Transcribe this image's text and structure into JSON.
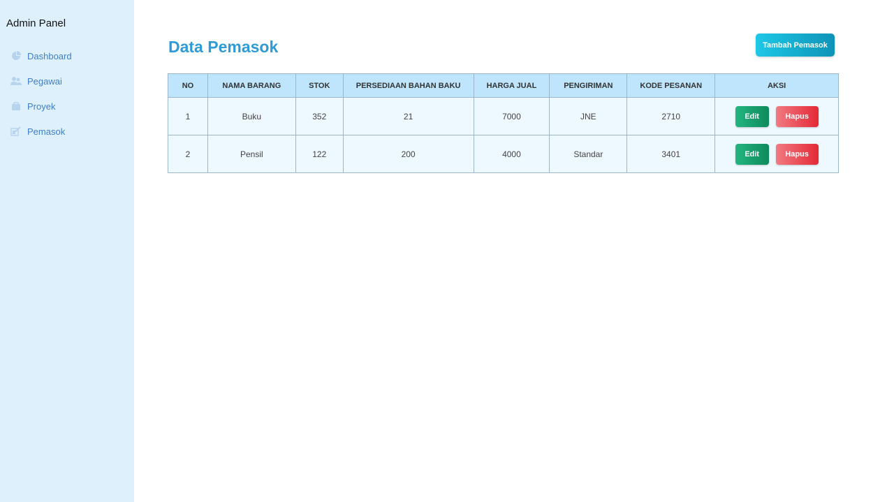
{
  "sidebar": {
    "brand": "Admin Panel",
    "items": [
      {
        "label": "Dashboard",
        "icon": "pie-chart-icon"
      },
      {
        "label": "Pegawai",
        "icon": "users-icon"
      },
      {
        "label": "Proyek",
        "icon": "briefcase-icon"
      },
      {
        "label": "Pemasok",
        "icon": "supplier-icon"
      }
    ]
  },
  "main": {
    "title": "Data Pemasok",
    "add_button": "Tambah Pemasok"
  },
  "table": {
    "headers": [
      "NO",
      "NAMA BARANG",
      "STOK",
      "PERSEDIAAN BAHAN BAKU",
      "HARGA JUAL",
      "PENGIRIMAN",
      "KODE PESANAN",
      "AKSI"
    ],
    "rows": [
      [
        "1",
        "Buku",
        "352",
        "21",
        "7000",
        "JNE",
        "2710"
      ],
      [
        "2",
        "Pensil",
        "122",
        "200",
        "4000",
        "Standar",
        "3401"
      ]
    ],
    "edit_label": "Edit",
    "delete_label": "Hapus"
  },
  "colors": {
    "sidebar_bg": "#dff0fd",
    "title": "#2e9bd6",
    "edit": "#1aa572",
    "delete": "#e8434d"
  }
}
